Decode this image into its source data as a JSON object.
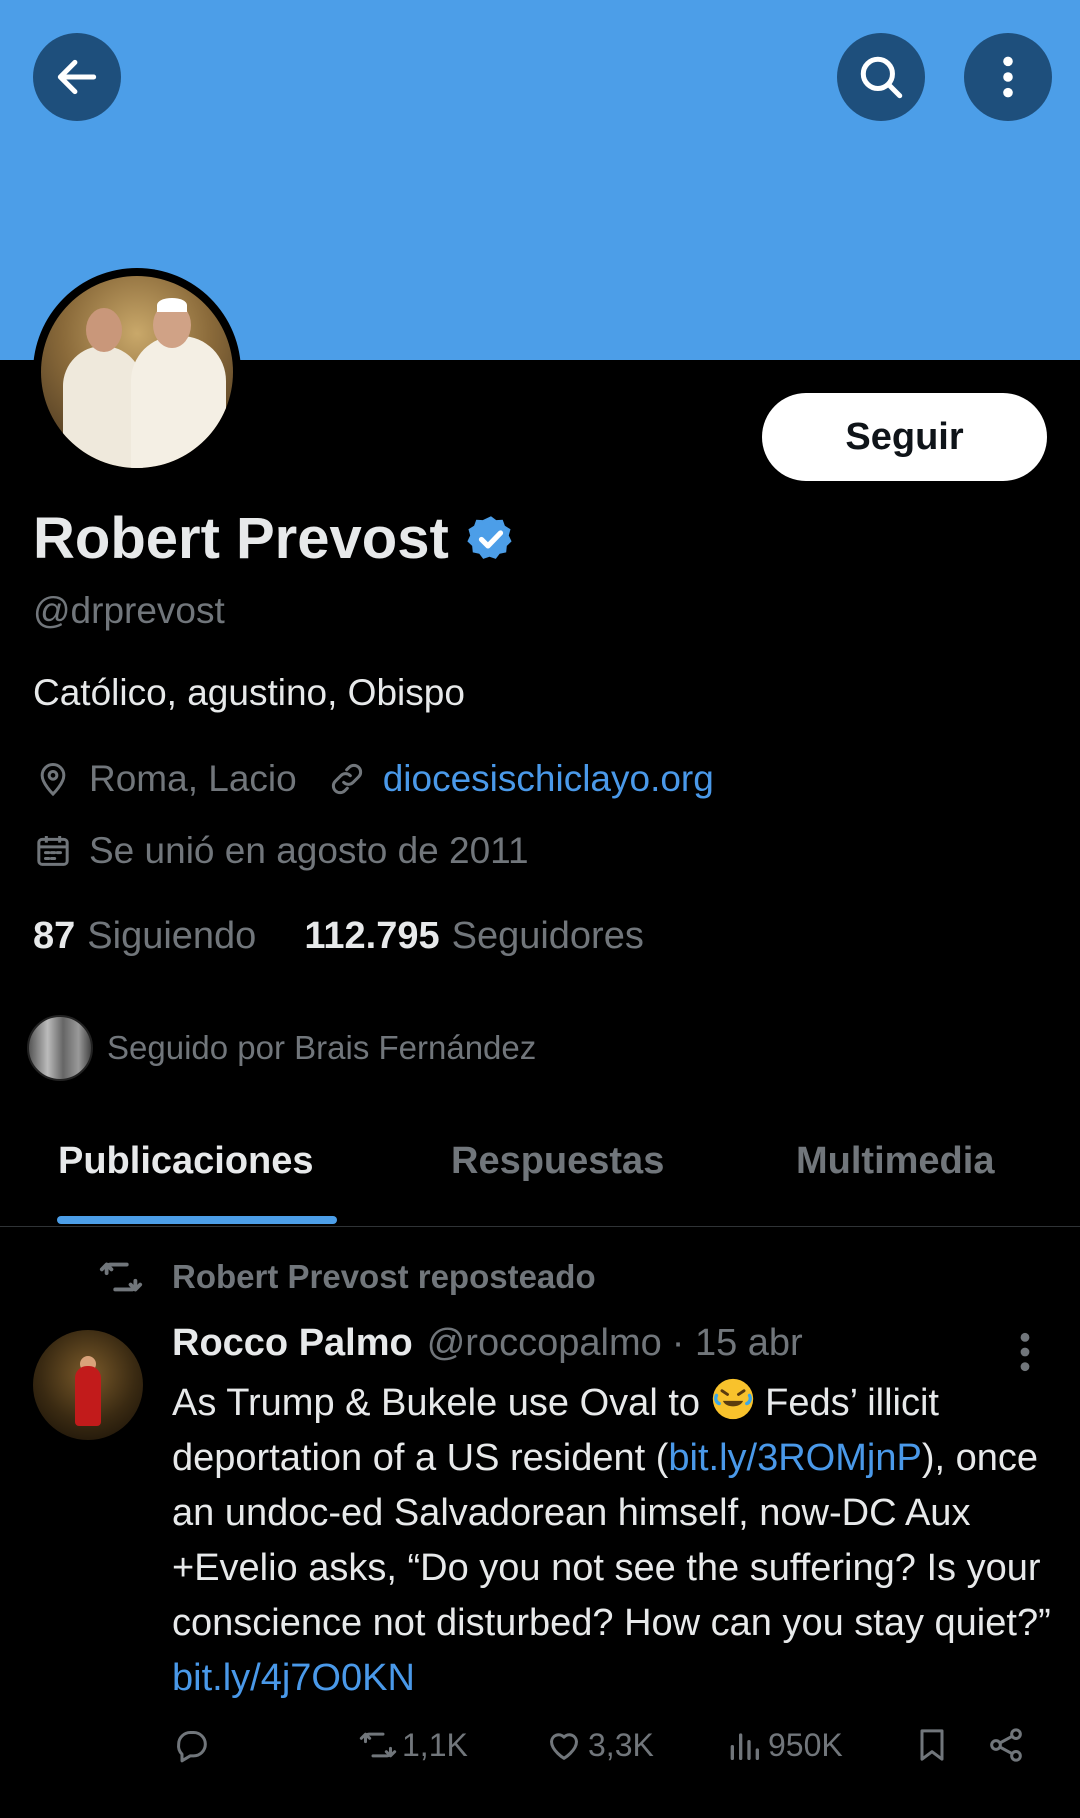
{
  "header": {
    "back_icon": "arrow-left-icon",
    "search_icon": "search-icon",
    "more_icon": "more-vertical-icon",
    "banner_color": "#4c9ee8"
  },
  "profile": {
    "follow_label": "Seguir",
    "name": "Robert Prevost",
    "verified": true,
    "handle": "@drprevost",
    "bio": "Católico, agustino, Obispo",
    "location": "Roma, Lacio",
    "website": "diocesischiclayo.org",
    "joined": "Se unió en agosto de 2011",
    "following_count": "87",
    "following_label": "Siguiendo",
    "followers_count": "112.795",
    "followers_label": "Seguidores",
    "followed_by": "Seguido por Brais Fernández"
  },
  "tabs": [
    {
      "label": "Publicaciones",
      "active": true
    },
    {
      "label": "Respuestas",
      "active": false
    },
    {
      "label": "Multimedia",
      "active": false
    }
  ],
  "tweet": {
    "repost_label": "Robert Prevost reposteado",
    "author_name": "Rocco Palmo",
    "author_handle": "@roccopalmo",
    "time": "· 15 abr",
    "text_1": "As Trump & Bukele use Oval to ",
    "text_2": " Feds’ illicit deportation of a US resident (",
    "link_1": "bit.ly/3ROMjnP",
    "text_3": "), once an undoc-ed Salvadorean himself, now-DC Aux +Evelio asks, “Do you not see the suffering? Is your conscience not disturbed? How can you stay quiet?” ",
    "link_2": "bit.ly/4j7O0KN",
    "reposts": "1,1K",
    "likes": "3,3K",
    "views": "950K"
  },
  "colors": {
    "accent": "#4c9ee8",
    "link": "#4a99e9",
    "muted": "#71767b"
  }
}
